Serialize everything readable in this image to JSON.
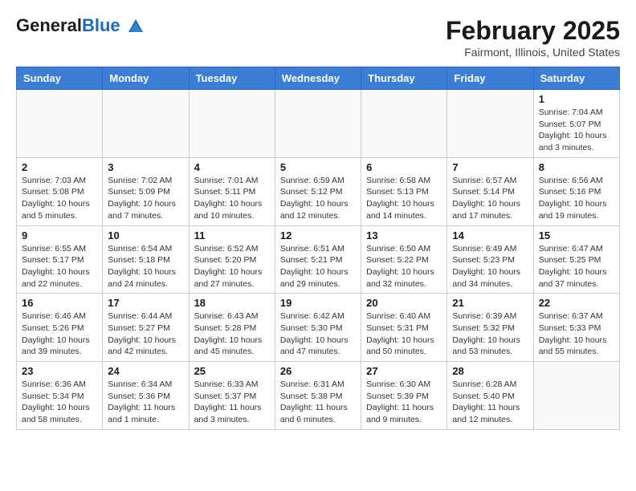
{
  "logo": {
    "text_general": "General",
    "text_blue": "Blue"
  },
  "header": {
    "month": "February 2025",
    "location": "Fairmont, Illinois, United States"
  },
  "weekdays": [
    "Sunday",
    "Monday",
    "Tuesday",
    "Wednesday",
    "Thursday",
    "Friday",
    "Saturday"
  ],
  "weeks": [
    [
      {
        "day": "",
        "info": ""
      },
      {
        "day": "",
        "info": ""
      },
      {
        "day": "",
        "info": ""
      },
      {
        "day": "",
        "info": ""
      },
      {
        "day": "",
        "info": ""
      },
      {
        "day": "",
        "info": ""
      },
      {
        "day": "1",
        "info": "Sunrise: 7:04 AM\nSunset: 5:07 PM\nDaylight: 10 hours and 3 minutes."
      }
    ],
    [
      {
        "day": "2",
        "info": "Sunrise: 7:03 AM\nSunset: 5:08 PM\nDaylight: 10 hours and 5 minutes."
      },
      {
        "day": "3",
        "info": "Sunrise: 7:02 AM\nSunset: 5:09 PM\nDaylight: 10 hours and 7 minutes."
      },
      {
        "day": "4",
        "info": "Sunrise: 7:01 AM\nSunset: 5:11 PM\nDaylight: 10 hours and 10 minutes."
      },
      {
        "day": "5",
        "info": "Sunrise: 6:59 AM\nSunset: 5:12 PM\nDaylight: 10 hours and 12 minutes."
      },
      {
        "day": "6",
        "info": "Sunrise: 6:58 AM\nSunset: 5:13 PM\nDaylight: 10 hours and 14 minutes."
      },
      {
        "day": "7",
        "info": "Sunrise: 6:57 AM\nSunset: 5:14 PM\nDaylight: 10 hours and 17 minutes."
      },
      {
        "day": "8",
        "info": "Sunrise: 6:56 AM\nSunset: 5:16 PM\nDaylight: 10 hours and 19 minutes."
      }
    ],
    [
      {
        "day": "9",
        "info": "Sunrise: 6:55 AM\nSunset: 5:17 PM\nDaylight: 10 hours and 22 minutes."
      },
      {
        "day": "10",
        "info": "Sunrise: 6:54 AM\nSunset: 5:18 PM\nDaylight: 10 hours and 24 minutes."
      },
      {
        "day": "11",
        "info": "Sunrise: 6:52 AM\nSunset: 5:20 PM\nDaylight: 10 hours and 27 minutes."
      },
      {
        "day": "12",
        "info": "Sunrise: 6:51 AM\nSunset: 5:21 PM\nDaylight: 10 hours and 29 minutes."
      },
      {
        "day": "13",
        "info": "Sunrise: 6:50 AM\nSunset: 5:22 PM\nDaylight: 10 hours and 32 minutes."
      },
      {
        "day": "14",
        "info": "Sunrise: 6:49 AM\nSunset: 5:23 PM\nDaylight: 10 hours and 34 minutes."
      },
      {
        "day": "15",
        "info": "Sunrise: 6:47 AM\nSunset: 5:25 PM\nDaylight: 10 hours and 37 minutes."
      }
    ],
    [
      {
        "day": "16",
        "info": "Sunrise: 6:46 AM\nSunset: 5:26 PM\nDaylight: 10 hours and 39 minutes."
      },
      {
        "day": "17",
        "info": "Sunrise: 6:44 AM\nSunset: 5:27 PM\nDaylight: 10 hours and 42 minutes."
      },
      {
        "day": "18",
        "info": "Sunrise: 6:43 AM\nSunset: 5:28 PM\nDaylight: 10 hours and 45 minutes."
      },
      {
        "day": "19",
        "info": "Sunrise: 6:42 AM\nSunset: 5:30 PM\nDaylight: 10 hours and 47 minutes."
      },
      {
        "day": "20",
        "info": "Sunrise: 6:40 AM\nSunset: 5:31 PM\nDaylight: 10 hours and 50 minutes."
      },
      {
        "day": "21",
        "info": "Sunrise: 6:39 AM\nSunset: 5:32 PM\nDaylight: 10 hours and 53 minutes."
      },
      {
        "day": "22",
        "info": "Sunrise: 6:37 AM\nSunset: 5:33 PM\nDaylight: 10 hours and 55 minutes."
      }
    ],
    [
      {
        "day": "23",
        "info": "Sunrise: 6:36 AM\nSunset: 5:34 PM\nDaylight: 10 hours and 58 minutes."
      },
      {
        "day": "24",
        "info": "Sunrise: 6:34 AM\nSunset: 5:36 PM\nDaylight: 11 hours and 1 minute."
      },
      {
        "day": "25",
        "info": "Sunrise: 6:33 AM\nSunset: 5:37 PM\nDaylight: 11 hours and 3 minutes."
      },
      {
        "day": "26",
        "info": "Sunrise: 6:31 AM\nSunset: 5:38 PM\nDaylight: 11 hours and 6 minutes."
      },
      {
        "day": "27",
        "info": "Sunrise: 6:30 AM\nSunset: 5:39 PM\nDaylight: 11 hours and 9 minutes."
      },
      {
        "day": "28",
        "info": "Sunrise: 6:28 AM\nSunset: 5:40 PM\nDaylight: 11 hours and 12 minutes."
      },
      {
        "day": "",
        "info": ""
      }
    ]
  ]
}
